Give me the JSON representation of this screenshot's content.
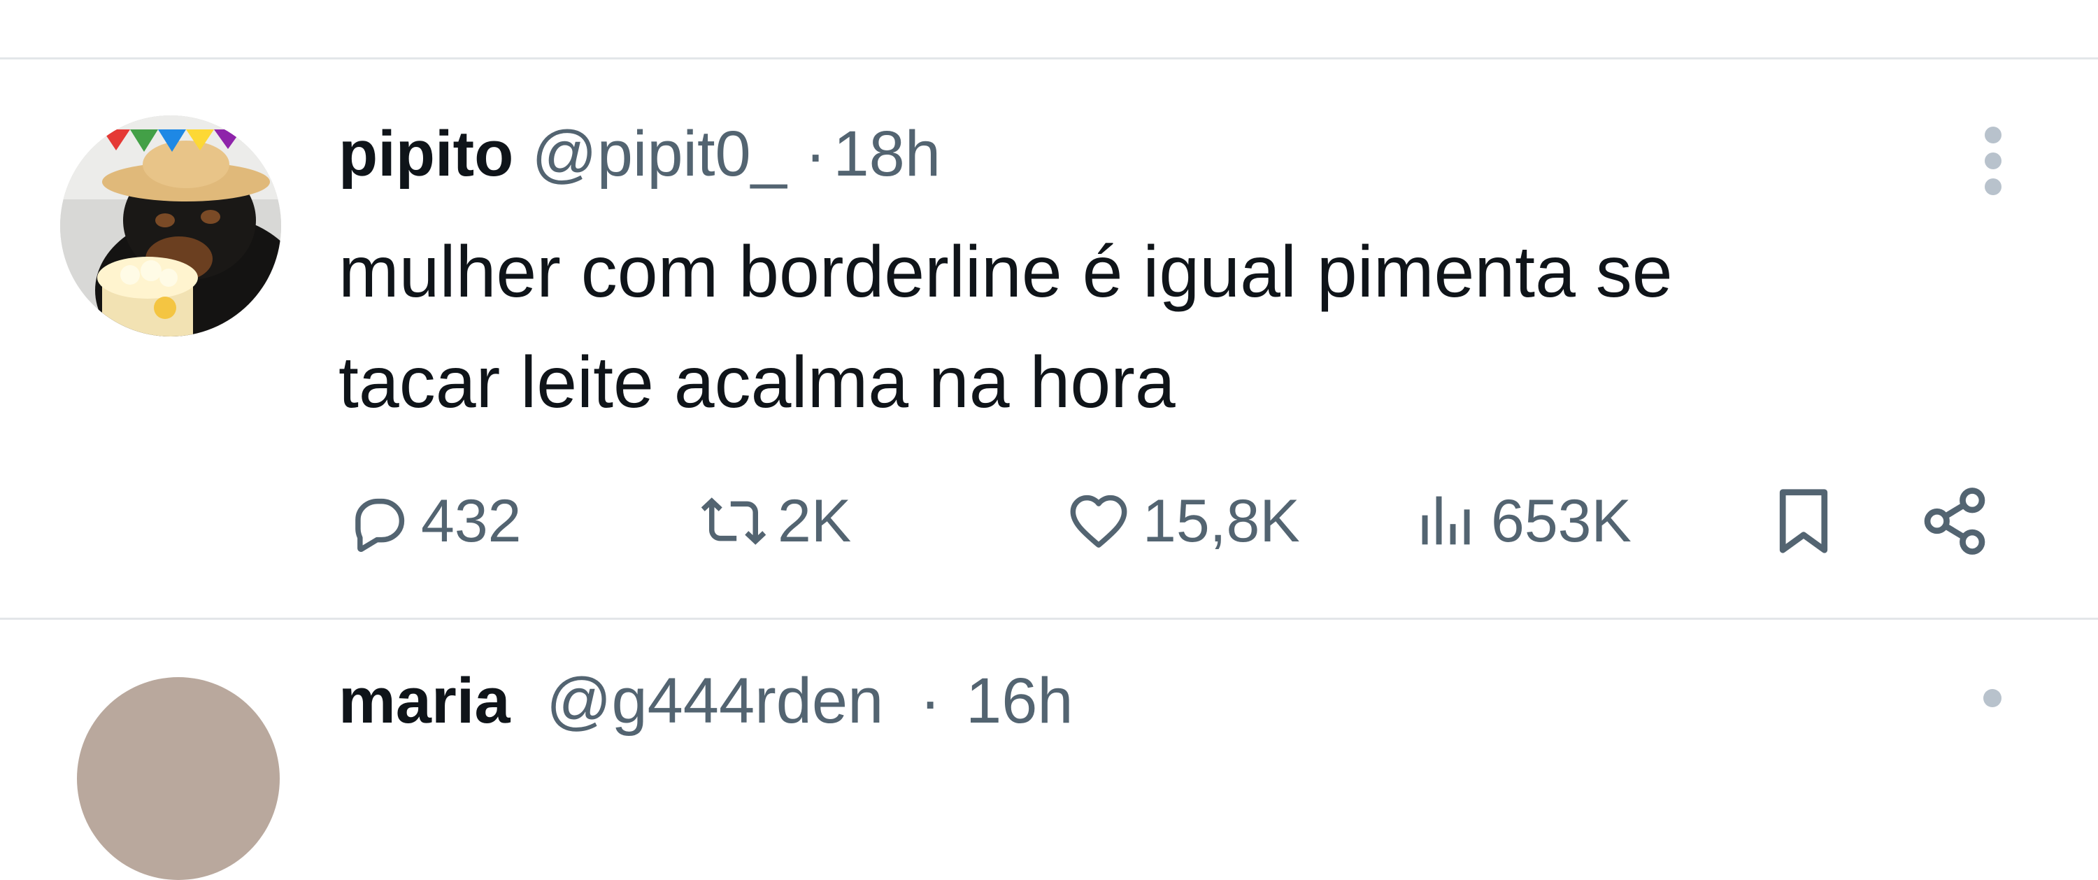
{
  "tweet": {
    "display_name": "pipito",
    "handle": "@pipit0_",
    "separator": "·",
    "time": "18h",
    "text_line1": "mulher com borderline é igual pimenta se",
    "text_line2": "tacar leite acalma na hora",
    "stats": {
      "replies": "432",
      "retweets": "2K",
      "likes": "15,8K",
      "views": "653K"
    },
    "avatar": "dog-with-straw-hat-and-popcorn"
  },
  "next_tweet": {
    "display_name": "maria",
    "handle": "@g444rden",
    "separator": "·",
    "time": "16h"
  },
  "icons": {
    "more": "more-vertical-icon",
    "reply": "reply-icon",
    "retweet": "retweet-icon",
    "like": "heart-icon",
    "views": "views-icon",
    "bookmark": "bookmark-icon",
    "share": "share-icon"
  },
  "colors": {
    "text": "#0f1419",
    "secondary": "#536471",
    "divider": "#e3e6e9"
  }
}
